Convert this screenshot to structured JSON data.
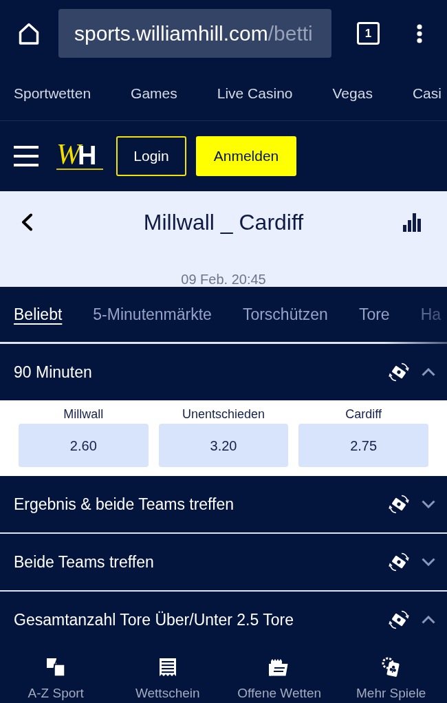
{
  "browser": {
    "url_host": "sports.williamhill.com",
    "url_path": "/betti",
    "tab_count": "1"
  },
  "site_nav": [
    "Sportwetten",
    "Games",
    "Live Casino",
    "Vegas",
    "Casi"
  ],
  "header": {
    "logo": {
      "script_letter": "W",
      "block_letter": "H"
    },
    "login_button": "Login",
    "register_button": "Anmelden"
  },
  "event": {
    "title": "Millwall _ Cardiff",
    "date": "09 Feb. 20:45"
  },
  "market_tabs": [
    {
      "label": "Beliebt",
      "selected": true
    },
    {
      "label": "5-Minutenmärkte",
      "selected": false
    },
    {
      "label": "Torschützen",
      "selected": false
    },
    {
      "label": "Tore",
      "selected": false
    },
    {
      "label": "Ha",
      "selected": false
    }
  ],
  "markets": [
    {
      "title": "90 Minuten",
      "expanded": true,
      "selections": [
        {
          "label": "Millwall",
          "odds": "2.60"
        },
        {
          "label": "Unentschieden",
          "odds": "3.20"
        },
        {
          "label": "Cardiff",
          "odds": "2.75"
        }
      ]
    },
    {
      "title": "Ergebnis & beide Teams treffen",
      "expanded": false
    },
    {
      "title": "Beide Teams treffen",
      "expanded": false
    },
    {
      "title": "Gesamtanzahl Tore Über/Unter 2.5 Tore",
      "expanded": true
    }
  ],
  "bottom_nav": [
    {
      "label": "A-Z Sport",
      "kind": "sports"
    },
    {
      "label": "Wettschein",
      "kind": "betslip"
    },
    {
      "label": "Offene Wetten",
      "kind": "openbets"
    },
    {
      "label": "Mehr Spiele",
      "kind": "games"
    }
  ]
}
